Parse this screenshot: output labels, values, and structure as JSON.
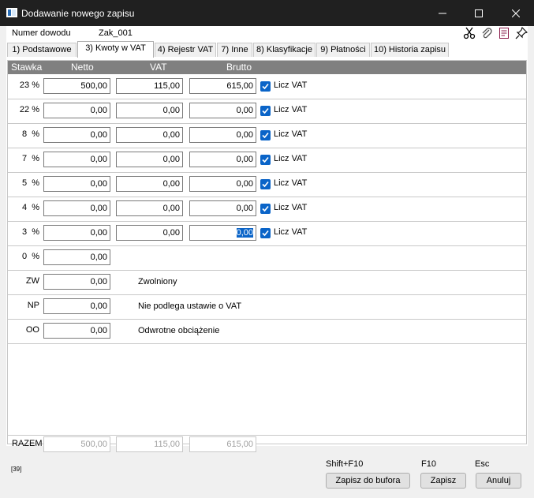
{
  "window": {
    "title": "Dodawanie nowego zapisu"
  },
  "header": {
    "numer_dowodu_label": "Numer dowodu",
    "numer_dowodu_value": "Zak_001"
  },
  "toolbar_icons": [
    "scissors-icon",
    "paperclip-icon",
    "document-icon",
    "pin-icon"
  ],
  "tabs": [
    {
      "label": "1) Podstawowe"
    },
    {
      "label": "3) Kwoty w VAT"
    },
    {
      "label": "4) Rejestr VAT"
    },
    {
      "label": "7) Inne"
    },
    {
      "label": "8) Klasyfikacje"
    },
    {
      "label": "9) Płatności"
    },
    {
      "label": "10) Historia zapisu"
    }
  ],
  "active_tab": "3) Kwoty w VAT",
  "columns": {
    "stawka": "Stawka",
    "netto": "Netto",
    "vat": "VAT",
    "brutto": "Brutto"
  },
  "rows": [
    {
      "rate": "23 %",
      "netto": "500,00",
      "vat": "115,00",
      "brutto": "615,00",
      "checkbox": "Licz VAT",
      "checked": true
    },
    {
      "rate": "22 %",
      "netto": "0,00",
      "vat": "0,00",
      "brutto": "0,00",
      "checkbox": "Licz VAT",
      "checked": true
    },
    {
      "rate": "8  %",
      "netto": "0,00",
      "vat": "0,00",
      "brutto": "0,00",
      "checkbox": "Licz VAT",
      "checked": true
    },
    {
      "rate": "7  %",
      "netto": "0,00",
      "vat": "0,00",
      "brutto": "0,00",
      "checkbox": "Licz VAT",
      "checked": true
    },
    {
      "rate": "5  %",
      "netto": "0,00",
      "vat": "0,00",
      "brutto": "0,00",
      "checkbox": "Licz VAT",
      "checked": true
    },
    {
      "rate": "4  %",
      "netto": "0,00",
      "vat": "0,00",
      "brutto": "0,00",
      "checkbox": "Licz VAT",
      "checked": true
    },
    {
      "rate": "3  %",
      "netto": "0,00",
      "vat": "0,00",
      "brutto": "0,00",
      "checkbox": "Licz VAT",
      "checked": true
    },
    {
      "rate": "0  %",
      "netto": "0,00"
    },
    {
      "rate": "ZW",
      "netto": "0,00",
      "description": "Zwolniony"
    },
    {
      "rate": "NP",
      "netto": "0,00",
      "description": "Nie podlega ustawie o VAT"
    },
    {
      "rate": "OO",
      "netto": "0,00",
      "description": "Odwrotne obciążenie"
    }
  ],
  "razem": {
    "label": "RAZEM",
    "netto": "500,00",
    "vat": "115,00",
    "brutto": "615,00"
  },
  "footer": {
    "code": "[39]",
    "buttons": [
      {
        "key": "Shift+F10",
        "label": "Zapisz do bufora"
      },
      {
        "key": "F10",
        "label": "Zapisz"
      },
      {
        "key": "Esc",
        "label": "Anuluj"
      }
    ]
  },
  "colors": {
    "titlebar": "#202020",
    "header": "#808080",
    "accent": "#0a64c8"
  }
}
